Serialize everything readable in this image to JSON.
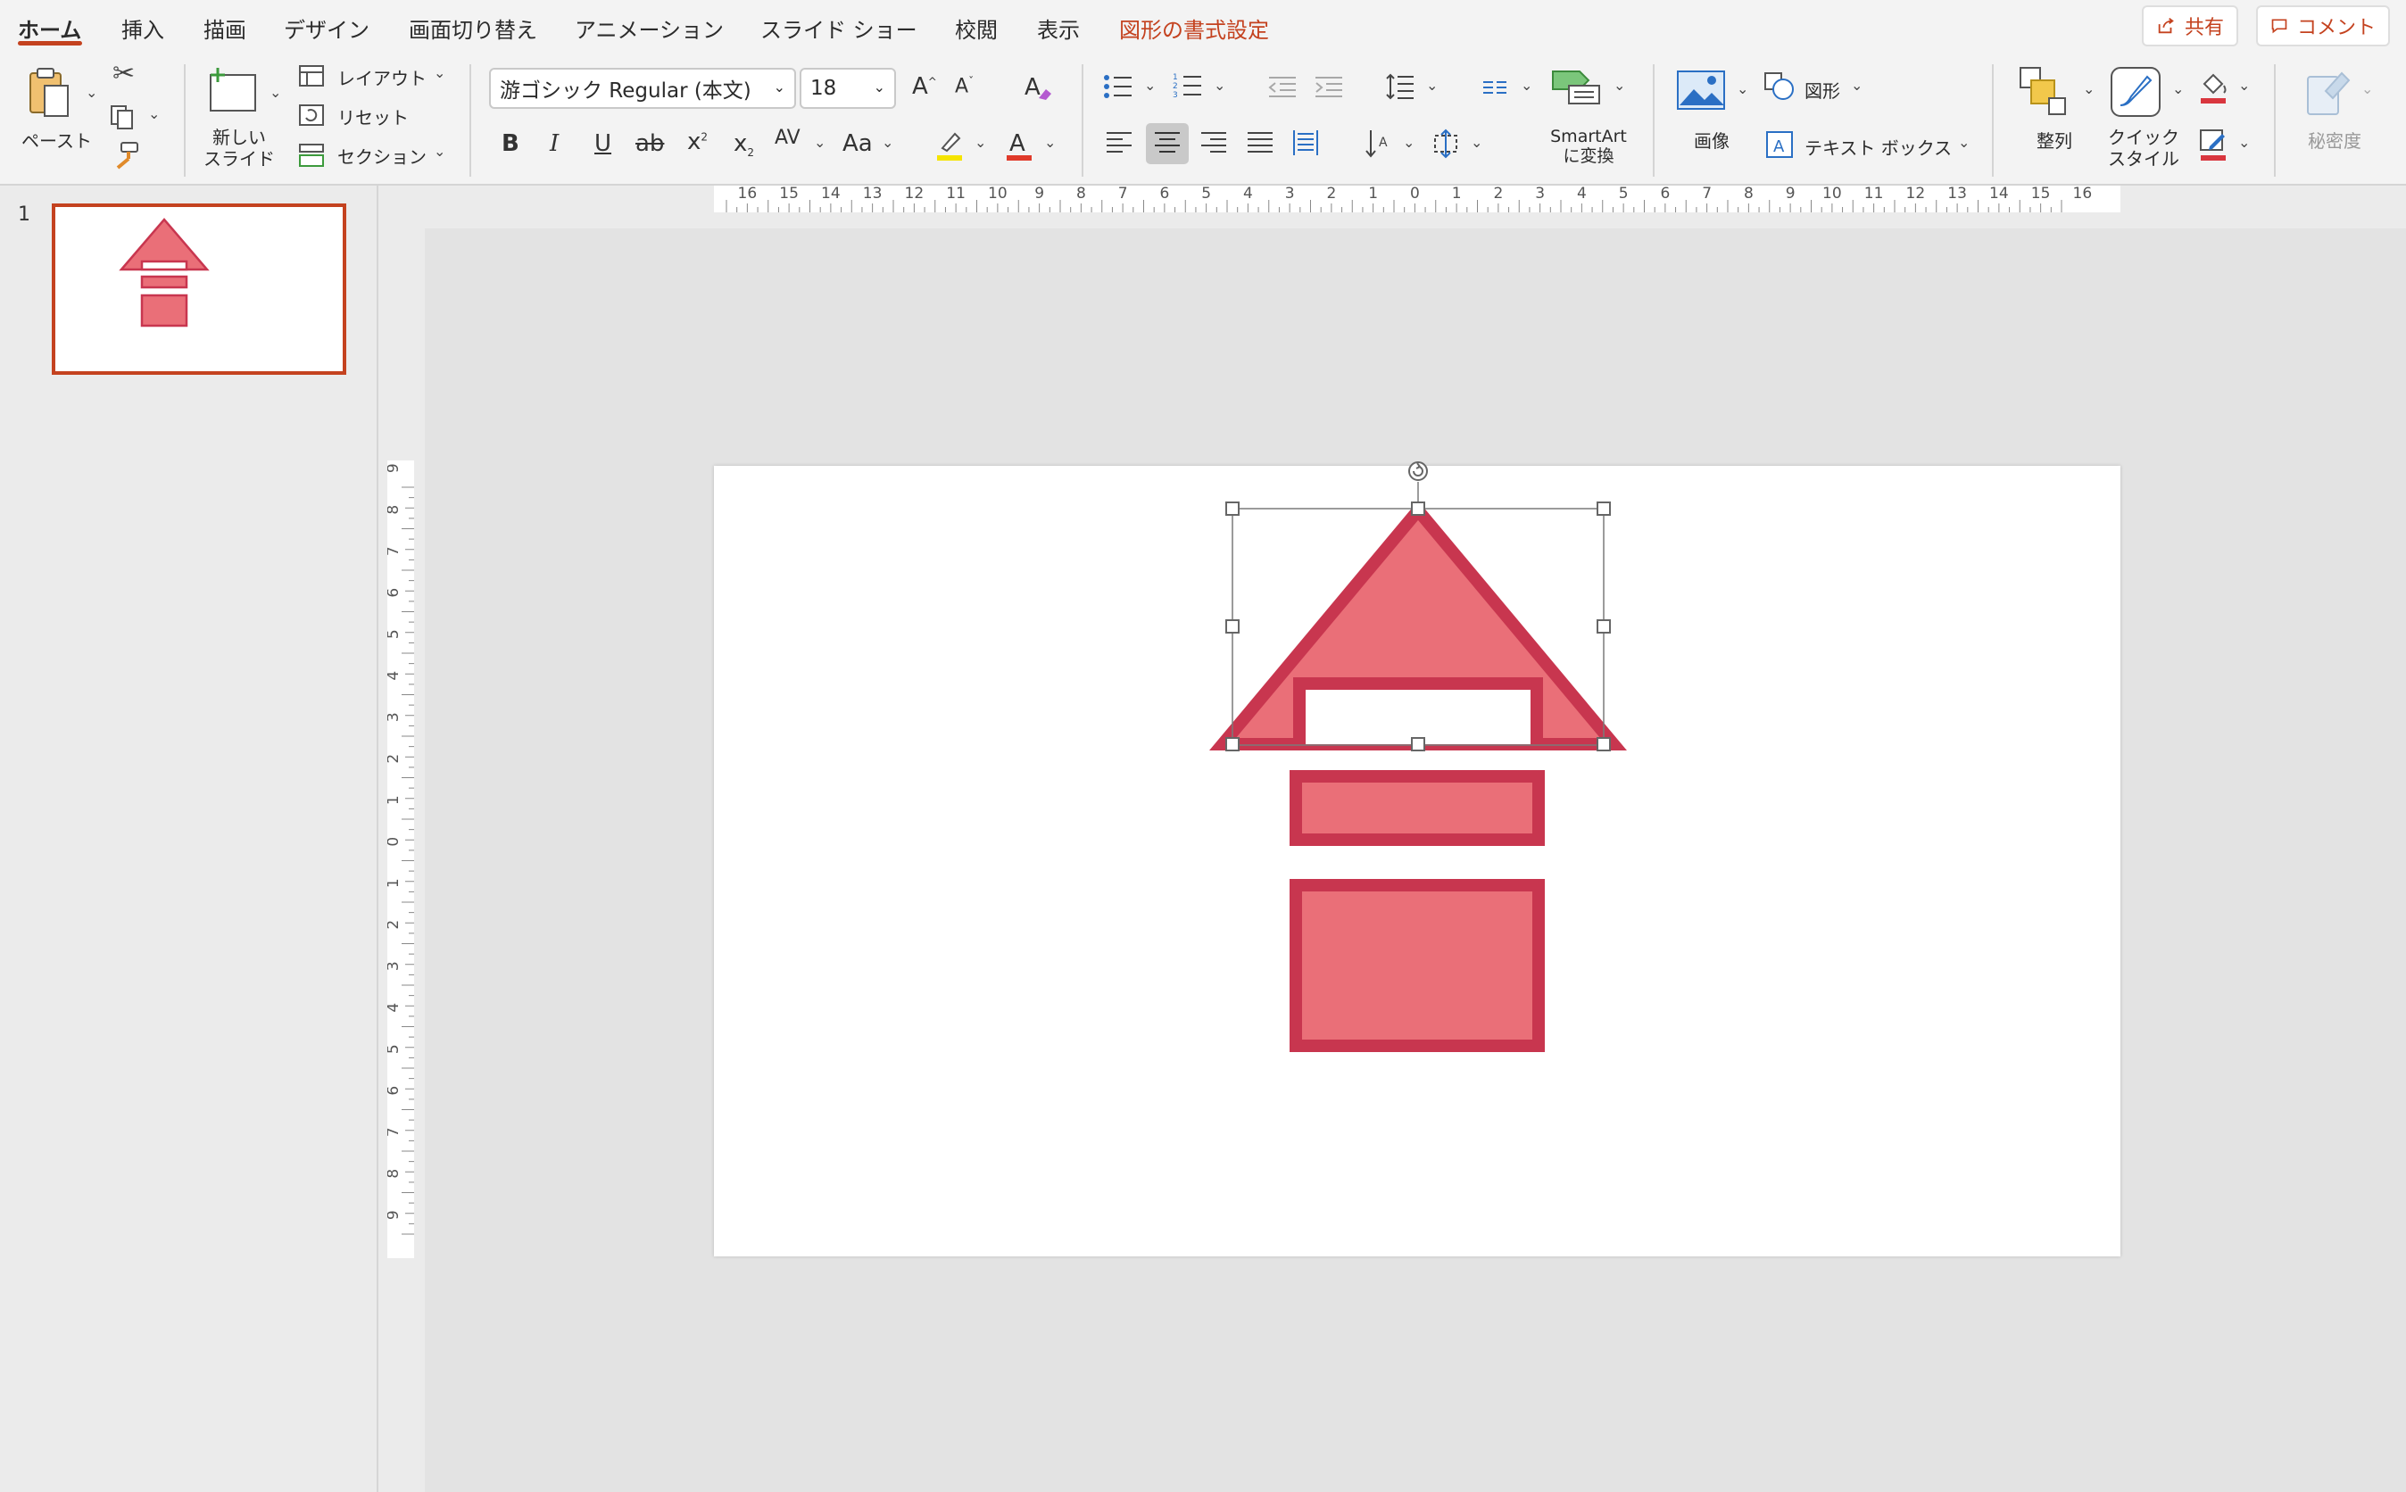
{
  "tabs": [
    {
      "label": "ホーム",
      "active": true
    },
    {
      "label": "挿入"
    },
    {
      "label": "描画"
    },
    {
      "label": "デザイン"
    },
    {
      "label": "画面切り替え"
    },
    {
      "label": "アニメーション"
    },
    {
      "label": "スライド ショー"
    },
    {
      "label": "校閲"
    },
    {
      "label": "表示"
    },
    {
      "label": "図形の書式設定",
      "contextual": true
    }
  ],
  "share_label": "共有",
  "comment_label": "コメント",
  "clipboard": {
    "paste_label": "ペースト"
  },
  "slides_group": {
    "new_slide_label_1": "新しい",
    "new_slide_label_2": "スライド",
    "layout_label": "レイアウト",
    "reset_label": "リセット",
    "section_label": "セクション"
  },
  "font": {
    "family": "游ゴシック Regular (本文)",
    "size": "18",
    "grow_glyph": "A",
    "shrink_glyph": "A",
    "bold": "B",
    "italic": "I",
    "underline": "U",
    "strike": "ab",
    "superscript": "x",
    "subscript": "x",
    "spacing": "AV",
    "case": "Aa",
    "font_color_glyph": "A",
    "highlight_color": "#f5e400",
    "font_color": "#e03a2a"
  },
  "paragraph": {
    "smartart_label_1": "SmartArt",
    "smartart_label_2": "に変換",
    "align_selected": "center"
  },
  "insert_group": {
    "picture_label": "画像",
    "shapes_label": "図形",
    "textbox_label": "テキスト ボックス"
  },
  "drawing_group": {
    "arrange_label": "整列",
    "quick_style_label_1": "クイック",
    "quick_style_label_2": "スタイル",
    "fill_color": "#d9363e",
    "line_color": "#d9363e"
  },
  "sensitivity_label": "秘密度",
  "slide_pane": {
    "slide_number": "1"
  },
  "rulers": {
    "horizontal_labels": [
      "16",
      "15",
      "14",
      "13",
      "12",
      "11",
      "10",
      "9",
      "8",
      "7",
      "6",
      "5",
      "4",
      "3",
      "2",
      "1",
      "0",
      "1",
      "2",
      "3",
      "4",
      "5",
      "6",
      "7",
      "8",
      "9",
      "10",
      "11",
      "12",
      "13",
      "14",
      "15",
      "16"
    ],
    "vertical_labels": [
      "9",
      "8",
      "7",
      "6",
      "5",
      "4",
      "3",
      "2",
      "1",
      "0",
      "1",
      "2",
      "3",
      "4",
      "5",
      "6",
      "7",
      "8",
      "9"
    ]
  },
  "colors": {
    "accent": "#c4421f",
    "shape_fill": "#ea6f78",
    "shape_stroke": "#c8364f",
    "selection": "#7a7a7a"
  }
}
